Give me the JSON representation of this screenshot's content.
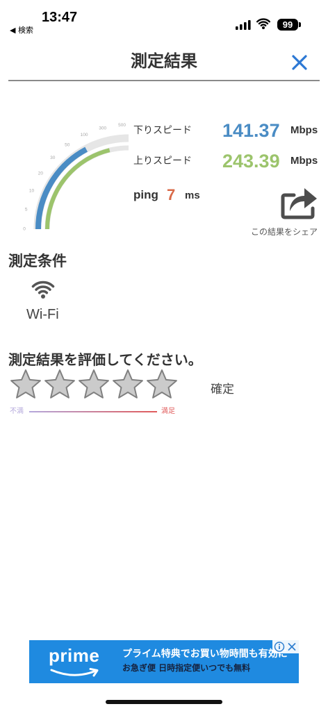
{
  "status_bar": {
    "time": "13:47",
    "back_label": "◀ 検索",
    "battery_level": "99",
    "icons": [
      "signal-icon",
      "wifi-icon",
      "battery-icon"
    ]
  },
  "header": {
    "title": "測定結果",
    "close_icon": "close-icon",
    "close_color": "#2c78d4"
  },
  "gauge": {
    "scale_labels": [
      "0",
      "5",
      "10",
      "20",
      "30",
      "50",
      "100",
      "300",
      "500"
    ],
    "download_fill": 0.69,
    "upload_fill": 0.85,
    "colors": {
      "download": "#4a8cc4",
      "upload": "#9cc46c",
      "track": "#e6e6e6",
      "scale": "#a8a8a8"
    }
  },
  "result": {
    "download": {
      "label": "下りスピード",
      "value": "141.37",
      "unit": "Mbps",
      "color": "#4a8cc4"
    },
    "upload": {
      "label": "上りスピード",
      "value": "243.39",
      "unit": "Mbps",
      "color": "#9cc46c"
    },
    "ping": {
      "label": "ping",
      "value": "7",
      "unit": "ms",
      "color": "#d96a48"
    },
    "share": {
      "label": "この結果をシェア",
      "icon": "share-icon"
    }
  },
  "conditions": {
    "heading": "測定条件",
    "network_icon": "wifi-icon",
    "network_label": "Wi-Fi"
  },
  "rating": {
    "heading": "測定結果を評価してください。",
    "value": 0,
    "max": 5,
    "confirm_label": "確定",
    "low_label": "不満",
    "high_label": "満足",
    "colors": {
      "star_fill": "#cbcbcb",
      "star_stroke": "#808080",
      "low": "#b4a8dc",
      "high": "#e05a5a"
    }
  },
  "ad_banner": {
    "brand": "prime",
    "headline": "プライム特典でお買い物時間も有効に",
    "subline": "お急ぎ便 日時指定便いつでも無料",
    "background": "#1f8ae0",
    "icons": [
      "info-icon",
      "close-icon"
    ]
  }
}
